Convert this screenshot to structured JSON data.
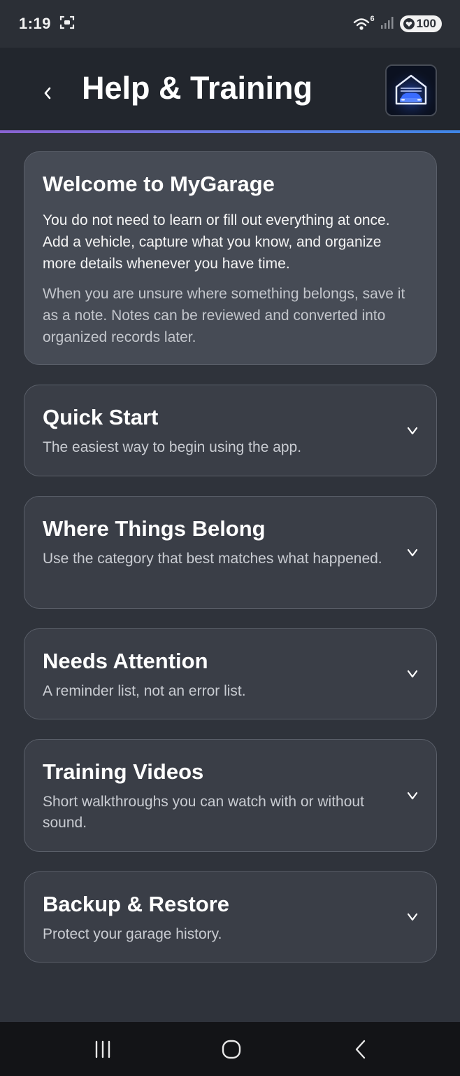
{
  "status_bar": {
    "time": "1:19",
    "wifi_superscript": "6",
    "battery": "100"
  },
  "header": {
    "title": "Help & Training",
    "back_icon": "chevron-left-icon",
    "logo_icon": "garage-car-icon"
  },
  "welcome": {
    "title": "Welcome to MyGarage",
    "body": "You do not need to learn or fill out everything at once. Add a vehicle, capture what you know, and organize more details whenever you have time.",
    "note": "When you are unsure where something belongs, save it as a note. Notes can be reviewed and converted into organized records later."
  },
  "sections": [
    {
      "title": "Quick Start",
      "subtitle": "The easiest way to begin using the app."
    },
    {
      "title": "Where Things Belong",
      "subtitle": "Use the category that best matches what happened."
    },
    {
      "title": "Needs Attention",
      "subtitle": "A reminder list, not an error list."
    },
    {
      "title": "Training Videos",
      "subtitle": "Short walkthroughs you can watch with or without sound."
    },
    {
      "title": "Backup & Restore",
      "subtitle": "Protect your garage history."
    }
  ],
  "colors": {
    "background": "#2f333b",
    "header": "#22262d",
    "accent_gradient_start": "#8a63d2",
    "accent_gradient_end": "#3f86e6",
    "card": "#3a3e47",
    "welcome_card": "#464b55"
  }
}
